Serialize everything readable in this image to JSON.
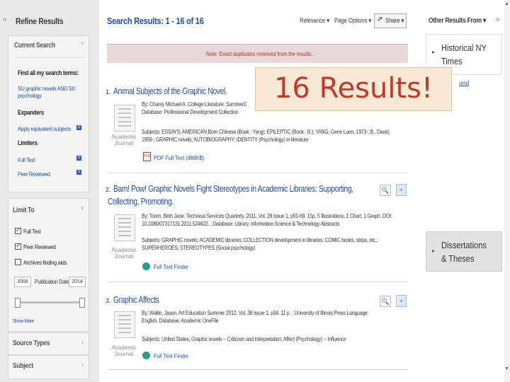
{
  "left": {
    "collapse_label": "«",
    "refine_title": "Refine Results",
    "current_search": "Current Search",
    "find_all_label": "Find all my search terms:",
    "search_terms_line1": "SU graphic novels AND SU",
    "search_terms_line2": "psychology",
    "expanders_label": "Expanders",
    "expander_item": "Apply equivalent subjects",
    "limiters_label": "Limiters",
    "limiter_full_text": "Full Text",
    "limiter_peer": "Peer Reviewed",
    "limit_to_title": "Limit To",
    "limit_full_text": "Full Text",
    "limit_peer": "Peer Reviewed",
    "limit_archives": "Archives finding aids",
    "date_from": "2006",
    "date_label": "Publication Date",
    "date_to": "2014",
    "show_more": "Show More",
    "source_types": "Source Types",
    "subject": "Subject"
  },
  "main": {
    "results_title": "Search Results: 1 - 16 of 16",
    "relevance": "Relevance ▾",
    "page_options": "Page Options ▾",
    "share": "Share ▾",
    "note": "Note: Exact duplicates removed from the results.",
    "results": [
      {
        "number": "1.",
        "title": "Animal Subjects of the Graphic Novel.",
        "line1": "By: Charey Michael A. College Literature. Summer2",
        "line2": "Database: Professional Development Collection",
        "subj1": "Subjects: ESSAYS; AMERICAN Born Chinese (Book : Yang); EPILEPTIC (Book : B.); YANG, Gene Luen, 1973-; B., David,",
        "subj2": "1959-; GRAPHIC novels; AUTOBIOGRAPHY; IDENTITY (Psychology) in literature",
        "type_a": "Academic",
        "type_b": "Journal",
        "link": "PDF Full Text (486KB)"
      },
      {
        "number": "2.",
        "title": "Bam! Pow! Graphic Novels Fight Stereotypes in Academic Libraries: Supporting,",
        "title2": "Collecting, Promoting.",
        "line1": "By: Toren, Beth Jane. Technical Services Quarterly. 2011, Vol. 28 Issue 1, p55-69. 15p. 5 Illustrations, 1 Chart, 1 Graph. DOI:",
        "line2": "10.1080/07317131.2011.524622. , Database: Library, Information Science & Technology Abstracts",
        "subj1": "Subjects: GRAPHIC novels; ACADEMIC libraries; COLLECTION development in libraries; COMIC books, strips, etc.;",
        "subj2": "SUPERHEROES; STEREOTYPES (Social psychology)",
        "type_a": "Academic",
        "type_b": "Journal",
        "link": "Full Text Finder"
      },
      {
        "number": "3.",
        "title": "Graphic Affects",
        "line1": "By: Wallin, Jason. Art Education Summer 2012, Vol. 38 Issue 1, p34. 11 p. ; University of Illinois Press Language:",
        "line2": "English, Database: Academic OneFile",
        "subj1": "Subjects: United States; Graphic novels -- Criticism and interpretation; Affect (Psychology) -- Influence",
        "subj2": "",
        "type_a": "Academic",
        "type_b": "Journal",
        "link": "Full Text Finder"
      }
    ]
  },
  "right": {
    "other_results": "Other Results From ▾",
    "collapse_label": "»",
    "nyt_title_line1": "Historical NY",
    "nyt_title_line2": "Times",
    "nyt_link_fragment": "und",
    "dissertations_line1": "Dissertations",
    "dissertations_line2": "& Theses"
  },
  "overlay_text": "16 Results!",
  "colors": {
    "accent": "#1f4fa5",
    "note_bg": "#e8d7d7",
    "note_text": "#b03030",
    "overlay_text": "#c0392b"
  }
}
